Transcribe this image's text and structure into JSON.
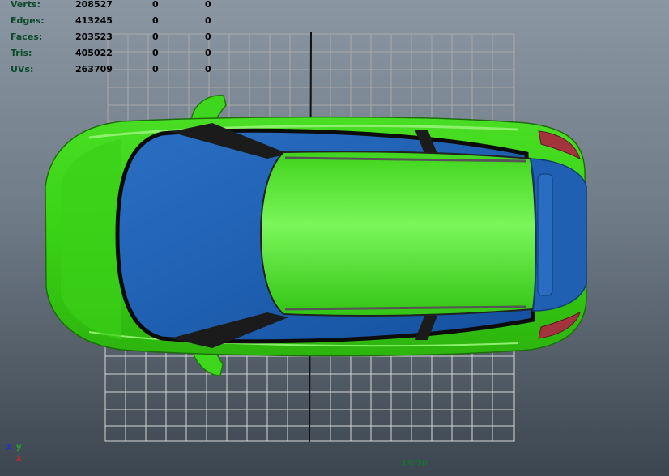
{
  "hud": {
    "stats": [
      {
        "label": "Verts:",
        "v1": "208527",
        "v2": "0",
        "v3": "0"
      },
      {
        "label": "Edges:",
        "v1": "413245",
        "v2": "0",
        "v3": "0"
      },
      {
        "label": "Faces:",
        "v1": "203523",
        "v2": "0",
        "v3": "0"
      },
      {
        "label": "Tris:",
        "v1": "405022",
        "v2": "0",
        "v3": "0"
      },
      {
        "label": "UVs:",
        "v1": "263709",
        "v2": "0",
        "v3": "0"
      }
    ]
  },
  "viewport": {
    "camera": "persp",
    "axes": {
      "z": "z",
      "y": "y",
      "x": "x"
    }
  },
  "colors": {
    "car_body": "#3fd61e",
    "glass": "#1e5fb0",
    "grid": "#c8c8c8",
    "taillight": "#a3343e"
  }
}
